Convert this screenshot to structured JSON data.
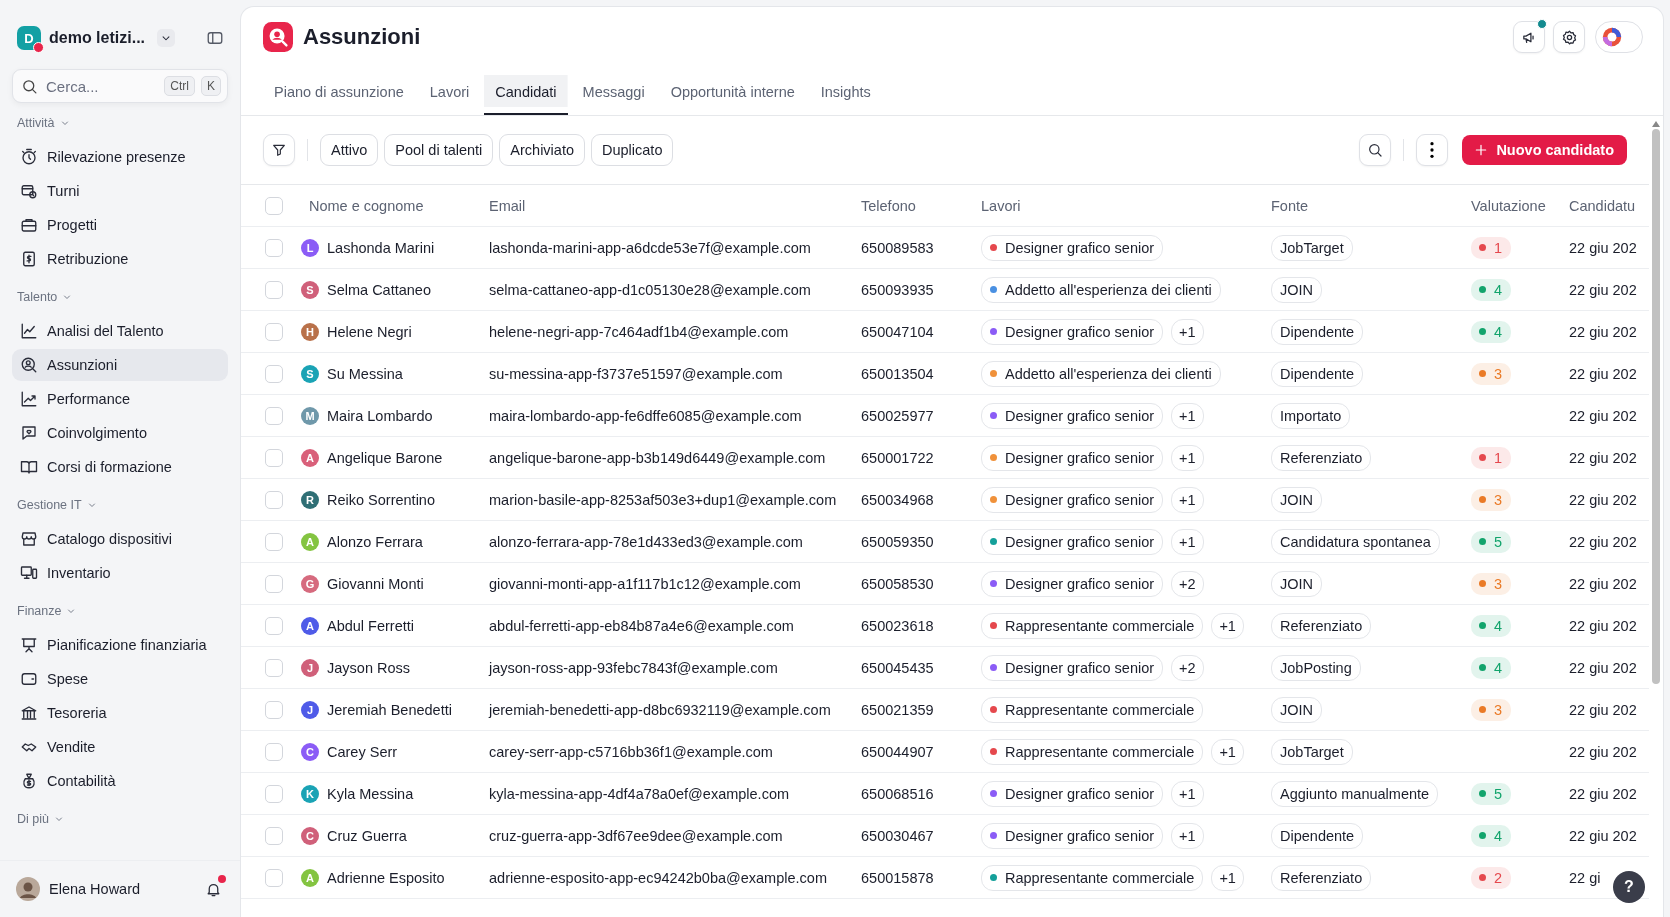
{
  "sidebar": {
    "workspace": {
      "initial": "D",
      "name": "demo letizi...",
      "has_alert": true
    },
    "search": {
      "placeholder": "Cerca...",
      "keys": [
        "Ctrl",
        "K"
      ]
    },
    "sections": [
      {
        "title": "Attività",
        "items": [
          {
            "label": "Rilevazione presenze",
            "selected": false
          },
          {
            "label": "Turni",
            "selected": false
          },
          {
            "label": "Progetti",
            "selected": false
          },
          {
            "label": "Retribuzione",
            "selected": false
          }
        ]
      },
      {
        "title": "Talento",
        "items": [
          {
            "label": "Analisi del Talento",
            "selected": false
          },
          {
            "label": "Assunzioni",
            "selected": true
          },
          {
            "label": "Performance",
            "selected": false
          },
          {
            "label": "Coinvolgimento",
            "selected": false
          },
          {
            "label": "Corsi di formazione",
            "selected": false
          }
        ]
      },
      {
        "title": "Gestione IT",
        "items": [
          {
            "label": "Catalogo dispositivi",
            "selected": false
          },
          {
            "label": "Inventario",
            "selected": false
          }
        ]
      },
      {
        "title": "Finanze",
        "items": [
          {
            "label": "Pianificazione finanziaria",
            "selected": false
          },
          {
            "label": "Spese",
            "selected": false
          },
          {
            "label": "Tesoreria",
            "selected": false
          },
          {
            "label": "Vendite",
            "selected": false
          },
          {
            "label": "Contabilità",
            "selected": false
          }
        ]
      },
      {
        "title": "Di più"
      }
    ],
    "user": {
      "name": "Elena Howard",
      "has_notifications": true
    }
  },
  "header": {
    "title": "Assunzioni",
    "announcements_unread": true
  },
  "tabs": [
    {
      "label": "Piano di assunzione",
      "selected": false
    },
    {
      "label": "Lavori",
      "selected": false
    },
    {
      "label": "Candidati",
      "selected": true
    },
    {
      "label": "Messaggi",
      "selected": false
    },
    {
      "label": "Opportunità interne",
      "selected": false
    },
    {
      "label": "Insights",
      "selected": false
    }
  ],
  "filters": [
    "Attivo",
    "Pool di talenti",
    "Archiviato",
    "Duplicato"
  ],
  "new_button": "Nuovo candidato",
  "table": {
    "select_all": {
      "checked": false
    },
    "columns": [
      "Nome e cognome",
      "Email",
      "Telefono",
      "Lavori",
      "Fonte",
      "Valutazione",
      "Candidatu"
    ],
    "rows": [
      {
        "checked": false,
        "avatar": {
          "initial": "L",
          "color": "#8b5cf6"
        },
        "name": "Lashonda Marini",
        "email": "lashonda-marini-app-a6dcde53e7f@example.com",
        "phone": "650089583",
        "job": {
          "title": "Designer grafico senior",
          "color": "#e5484d"
        },
        "more_jobs": "",
        "source": "JobTarget",
        "rating": {
          "value": "1",
          "color": "#e5484d"
        }
      },
      {
        "checked": false,
        "avatar": {
          "initial": "S",
          "color": "#d0607a"
        },
        "name": "Selma Cattaneo",
        "email": "selma-cattaneo-app-d1c05130e28@example.com",
        "phone": "650093935",
        "job": {
          "title": "Addetto all'esperienza dei clienti",
          "color": "#4a90e2"
        },
        "more_jobs": "",
        "source": "JOIN",
        "rating": {
          "value": "4",
          "color": "#12a46c"
        }
      },
      {
        "checked": false,
        "avatar": {
          "initial": "H",
          "color": "#b9714a"
        },
        "name": "Helene Negri",
        "email": "helene-negri-app-7c464adf1b4@example.com",
        "phone": "650047104",
        "job": {
          "title": "Designer grafico senior",
          "color": "#8b5cf6"
        },
        "more_jobs": "+1",
        "source": "Dipendente",
        "rating": {
          "value": "4",
          "color": "#12a46c"
        }
      },
      {
        "checked": false,
        "avatar": {
          "initial": "S",
          "color": "#1aa3b5"
        },
        "name": "Su Messina",
        "email": "su-messina-app-f3737e51597@example.com",
        "phone": "650013504",
        "job": {
          "title": "Addetto all'esperienza dei clienti",
          "color": "#f0913a"
        },
        "more_jobs": "",
        "source": "Dipendente",
        "rating": {
          "value": "3",
          "color": "#ea7a26"
        }
      },
      {
        "checked": false,
        "avatar": {
          "initial": "M",
          "color": "#6f98aa"
        },
        "name": "Maira Lombardo",
        "email": "maira-lombardo-app-fe6dffe6085@example.com",
        "phone": "650025977",
        "job": {
          "title": "Designer grafico senior",
          "color": "#8b5cf6"
        },
        "more_jobs": "+1",
        "source": "Importato",
        "rating": null
      },
      {
        "checked": false,
        "avatar": {
          "initial": "A",
          "color": "#d9607a"
        },
        "name": "Angelique Barone",
        "email": "angelique-barone-app-b3b149d6449@example.com",
        "phone": "650001722",
        "job": {
          "title": "Designer grafico senior",
          "color": "#f0913a"
        },
        "more_jobs": "+1",
        "source": "Referenziato",
        "rating": {
          "value": "1",
          "color": "#e5484d"
        }
      },
      {
        "checked": false,
        "avatar": {
          "initial": "R",
          "color": "#2f6f75"
        },
        "name": "Reiko Sorrentino",
        "email": "marion-basile-app-8253af503e3+dup1@example.com",
        "phone": "650034968",
        "job": {
          "title": "Designer grafico senior",
          "color": "#f0913a"
        },
        "more_jobs": "+1",
        "source": "JOIN",
        "rating": {
          "value": "3",
          "color": "#ea7a26"
        }
      },
      {
        "checked": false,
        "avatar": {
          "initial": "A",
          "color": "#84c441"
        },
        "name": "Alonzo Ferrara",
        "email": "alonzo-ferrara-app-78e1d433ed3@example.com",
        "phone": "650059350",
        "job": {
          "title": "Designer grafico senior",
          "color": "#14a09a"
        },
        "more_jobs": "+1",
        "source": "Candidatura spontanea",
        "rating": {
          "value": "5",
          "color": "#12a46c"
        }
      },
      {
        "checked": false,
        "avatar": {
          "initial": "G",
          "color": "#d66a7e"
        },
        "name": "Giovanni Monti",
        "email": "giovanni-monti-app-a1f117b1c12@example.com",
        "phone": "650058530",
        "job": {
          "title": "Designer grafico senior",
          "color": "#8b5cf6"
        },
        "more_jobs": "+2",
        "source": "JOIN",
        "rating": {
          "value": "3",
          "color": "#ea7a26"
        }
      },
      {
        "checked": false,
        "avatar": {
          "initial": "A",
          "color": "#4f5be8"
        },
        "name": "Abdul Ferretti",
        "email": "abdul-ferretti-app-eb84b87a4e6@example.com",
        "phone": "650023618",
        "job": {
          "title": "Rappresentante commerciale",
          "color": "#e5484d"
        },
        "more_jobs": "+1",
        "source": "Referenziato",
        "rating": {
          "value": "4",
          "color": "#12a46c"
        }
      },
      {
        "checked": false,
        "avatar": {
          "initial": "J",
          "color": "#d0607a"
        },
        "name": "Jayson Ross",
        "email": "jayson-ross-app-93febc7843f@example.com",
        "phone": "650045435",
        "job": {
          "title": "Designer grafico senior",
          "color": "#8b5cf6"
        },
        "more_jobs": "+2",
        "source": "JobPosting",
        "rating": {
          "value": "4",
          "color": "#12a46c"
        }
      },
      {
        "checked": false,
        "avatar": {
          "initial": "J",
          "color": "#4f5be8"
        },
        "name": "Jeremiah Benedetti",
        "email": "jeremiah-benedetti-app-d8bc6932119@example.com",
        "phone": "650021359",
        "job": {
          "title": "Rappresentante commerciale",
          "color": "#e5484d"
        },
        "more_jobs": "",
        "source": "JOIN",
        "rating": {
          "value": "3",
          "color": "#ea7a26"
        }
      },
      {
        "checked": false,
        "avatar": {
          "initial": "C",
          "color": "#8b5cf6"
        },
        "name": "Carey Serr",
        "email": "carey-serr-app-c5716bb36f1@example.com",
        "phone": "650044907",
        "job": {
          "title": "Rappresentante commerciale",
          "color": "#e5484d"
        },
        "more_jobs": "+1",
        "source": "JobTarget",
        "rating": null
      },
      {
        "checked": false,
        "avatar": {
          "initial": "K",
          "color": "#1aa3b5"
        },
        "name": "Kyla Messina",
        "email": "kyla-messina-app-4df4a78a0ef@example.com",
        "phone": "650068516",
        "job": {
          "title": "Designer grafico senior",
          "color": "#8b5cf6"
        },
        "more_jobs": "+1",
        "source": "Aggiunto manualmente",
        "rating": {
          "value": "5",
          "color": "#12a46c"
        }
      },
      {
        "checked": false,
        "avatar": {
          "initial": "C",
          "color": "#d0607a"
        },
        "name": "Cruz Guerra",
        "email": "cruz-guerra-app-3df67ee9dee@example.com",
        "phone": "650030467",
        "job": {
          "title": "Designer grafico senior",
          "color": "#8b5cf6"
        },
        "more_jobs": "+1",
        "source": "Dipendente",
        "rating": {
          "value": "4",
          "color": "#12a46c"
        }
      },
      {
        "checked": false,
        "avatar": {
          "initial": "A",
          "color": "#84c441"
        },
        "name": "Adrienne Esposito",
        "email": "adrienne-esposito-app-ec94242b0ba@example.com",
        "phone": "650015878",
        "job": {
          "title": "Rappresentante commerciale",
          "color": "#14a09a"
        },
        "more_jobs": "+1",
        "source": "Referenziato",
        "rating": {
          "value": "2",
          "color": "#e5484d"
        }
      }
    ],
    "applied_dates": [
      "22 giu 202",
      "22 giu 202",
      "22 giu 202",
      "22 giu 202",
      "22 giu 202",
      "22 giu 202",
      "22 giu 202",
      "22 giu 202",
      "22 giu 202",
      "22 giu 202",
      "22 giu 202",
      "22 giu 202",
      "22 giu 202",
      "22 giu 202",
      "22 giu 202",
      "22 gi"
    ]
  },
  "help_button": "?"
}
